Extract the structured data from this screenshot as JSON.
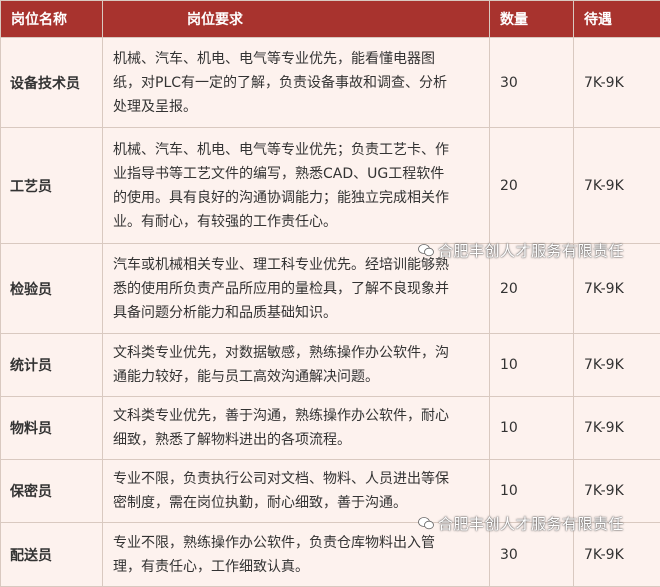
{
  "table": {
    "headers": {
      "name": "岗位名称",
      "requirements": "岗位要求",
      "count": "数量",
      "pay": "待遇"
    },
    "rows": [
      {
        "name": "设备技术员",
        "requirements": [
          "机械、汽车、机电、电气等专业优先，能看懂电器图",
          "纸，对PLC有一定的了解，负责设备事故和调查、分析",
          "处理及呈报。"
        ],
        "count": "30",
        "pay": "7K-9K"
      },
      {
        "name": "工艺员",
        "requirements": [
          "机械、汽车、机电、电气等专业优先；负责工艺卡、作",
          "业指导书等工艺文件的编写，熟悉CAD、UG工程软件",
          "的使用。具有良好的沟通协调能力；能独立完成相关作",
          "业。有耐心，有较强的工作责任心。"
        ],
        "count": "20",
        "pay": "7K-9K"
      },
      {
        "name": "检验员",
        "requirements": [
          "汽车或机械相关专业、理工科专业优先。经培训能够熟",
          "悉的使用所负责产品所应用的量检具，了解不良现象并",
          "具备问题分析能力和品质基础知识。"
        ],
        "count": "20",
        "pay": "7K-9K"
      },
      {
        "name": "统计员",
        "requirements": [
          "文科类专业优先，对数据敏感，熟练操作办公软件，沟",
          "通能力较好，能与员工高效沟通解决问题。"
        ],
        "count": "10",
        "pay": "7K-9K"
      },
      {
        "name": "物料员",
        "requirements": [
          "文科类专业优先，善于沟通，熟练操作办公软件，耐心",
          "细致，熟悉了解物料进出的各项流程。"
        ],
        "count": "10",
        "pay": "7K-9K"
      },
      {
        "name": "保密员",
        "requirements": [
          "专业不限，负责执行公司对文档、物料、人员进出等保",
          "密制度，需在岗位执勤，耐心细致，善于沟通。"
        ],
        "count": "10",
        "pay": "7K-9K"
      },
      {
        "name": "配送员",
        "requirements": [
          "专业不限，熟练操作办公软件，负责仓库物料出入管",
          "理，有责任心，工作细致认真。"
        ],
        "count": "30",
        "pay": "7K-9K"
      }
    ]
  },
  "watermarks": [
    {
      "text": "合肥丰创人才服务有限责任"
    },
    {
      "text": "合肥丰创人才服务有限责任"
    }
  ],
  "icons": {
    "watermark": "wechat-icon"
  },
  "colors": {
    "header_bg": "#a8332e",
    "row_bg": "#fdf2ee",
    "border": "#d9c9c0"
  }
}
